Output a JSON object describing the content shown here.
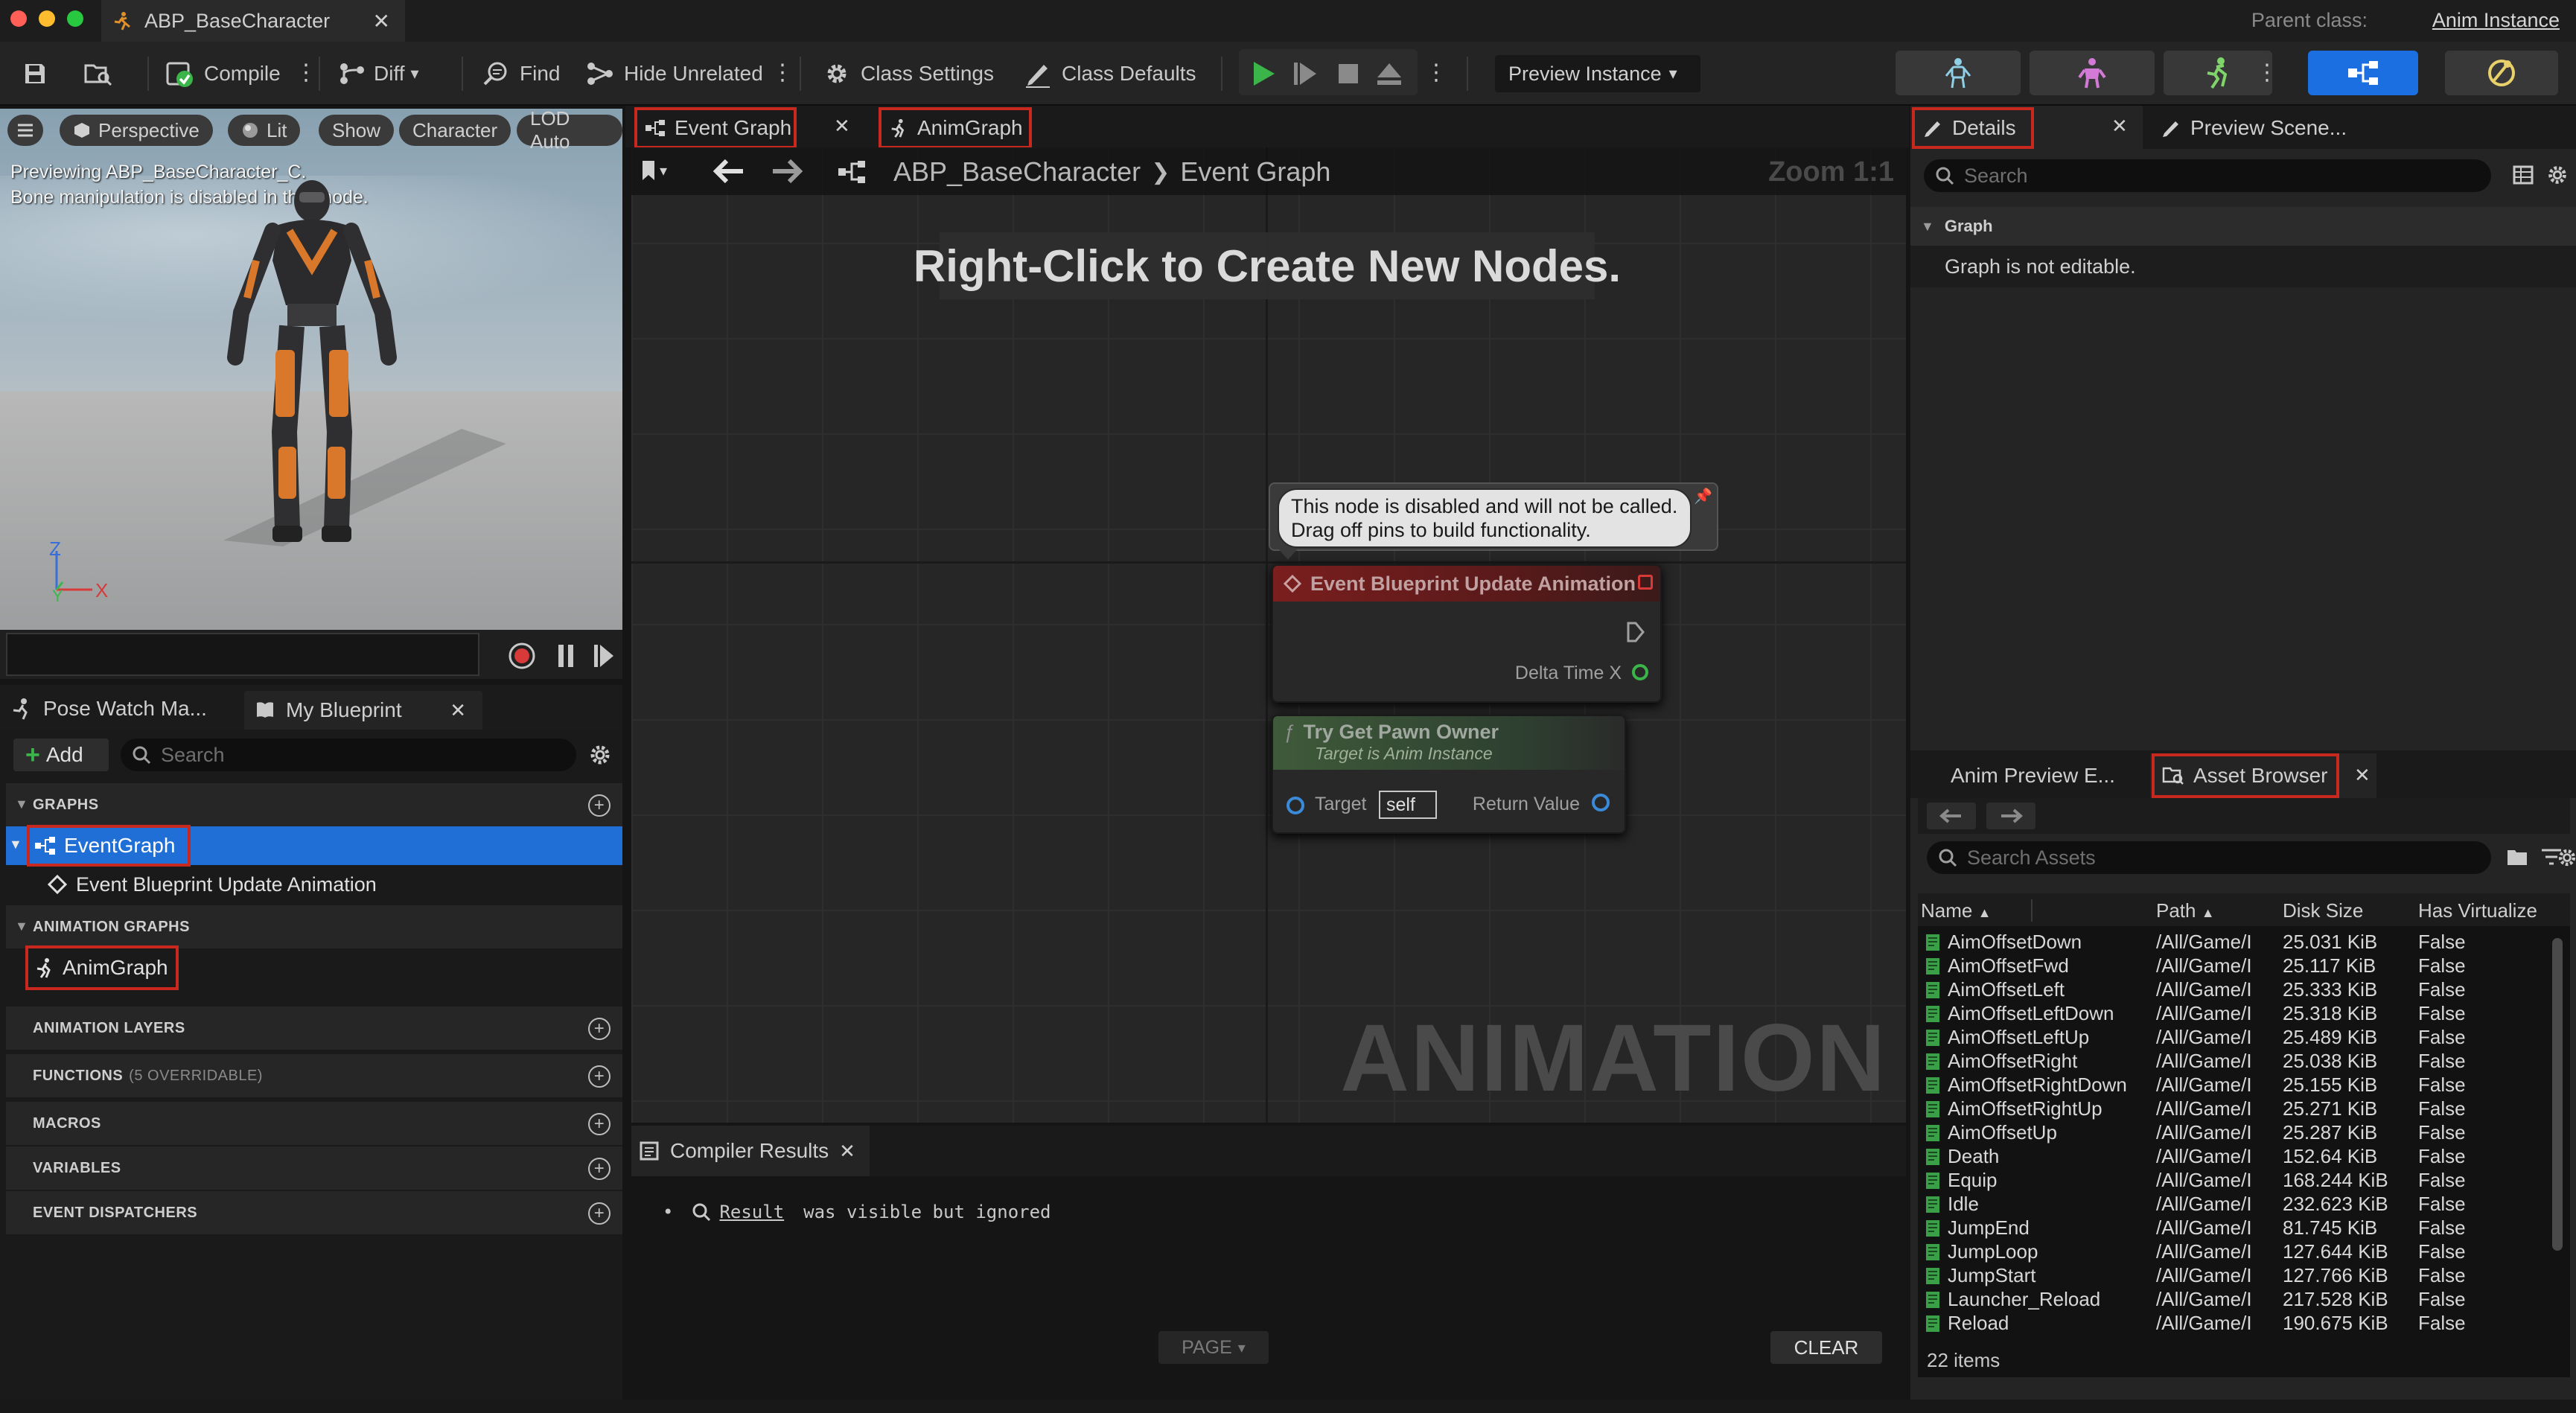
{
  "window": {
    "tab_title": "ABP_BaseCharacter",
    "parent_class_label": "Parent class:",
    "parent_class_value": "Anim Instance"
  },
  "toolbar": {
    "compile": "Compile",
    "diff": "Diff",
    "find": "Find",
    "hide_unrelated": "Hide Unrelated",
    "class_settings": "Class Settings",
    "class_defaults": "Class Defaults",
    "preview_instance": "Preview Instance"
  },
  "viewport": {
    "perspective": "Perspective",
    "lit": "Lit",
    "show": "Show",
    "character": "Character",
    "lod": "LOD Auto",
    "preview_line1": "Previewing ABP_BaseCharacter_C.",
    "preview_line2": "Bone manipulation is disabled in this mode.",
    "axis_z": "Z",
    "axis_y": "Y",
    "axis_x": "X"
  },
  "left_tabs": {
    "pose_watch": "Pose Watch Ma...",
    "my_blueprint": "My Blueprint"
  },
  "my_blueprint": {
    "add": "Add",
    "search_placeholder": "Search",
    "graphs": "GRAPHS",
    "event_graph": "EventGraph",
    "event_update": "Event Blueprint Update Animation",
    "animation_graphs": "ANIMATION GRAPHS",
    "anim_graph": "AnimGraph",
    "animation_layers": "ANIMATION LAYERS",
    "functions": "FUNCTIONS",
    "functions_note": "(5 OVERRIDABLE)",
    "macros": "MACROS",
    "variables": "VARIABLES",
    "event_dispatchers": "EVENT DISPATCHERS"
  },
  "graph_tabs": {
    "event_graph": "Event Graph",
    "anim_graph": "AnimGraph"
  },
  "graph": {
    "breadcrumb_root": "ABP_BaseCharacter",
    "breadcrumb_current": "Event Graph",
    "zoom": "Zoom 1:1",
    "hint": "Right-Click to Create New Nodes.",
    "watermark": "ANIMATION",
    "comment_line1": "This node is disabled and will not be called.",
    "comment_line2": "Drag off pins to build functionality.",
    "node1_title": "Event Blueprint Update Animation",
    "node1_pin": "Delta Time X",
    "node2_title": "Try Get Pawn Owner",
    "node2_subtitle": "Target is Anim Instance",
    "node2_target": "Target",
    "node2_self": "self",
    "node2_return": "Return Value"
  },
  "compiler": {
    "tab": "Compiler Results",
    "result_link": "Result",
    "result_text": "was visible but ignored",
    "page": "PAGE",
    "clear": "CLEAR"
  },
  "details": {
    "tab": "Details",
    "preview_tab": "Preview Scene...",
    "search_placeholder": "Search",
    "graph_section": "Graph",
    "not_editable": "Graph is not editable."
  },
  "asset_browser": {
    "anim_preview_tab": "Anim Preview E...",
    "tab": "Asset Browser",
    "search_placeholder": "Search Assets",
    "columns": [
      "Name",
      "Path",
      "Disk Size",
      "Has Virtualize"
    ],
    "rows": [
      [
        "AimOffsetDown",
        "/All/Game/I",
        "25.031 KiB",
        "False"
      ],
      [
        "AimOffsetFwd",
        "/All/Game/I",
        "25.117 KiB",
        "False"
      ],
      [
        "AimOffsetLeft",
        "/All/Game/I",
        "25.333 KiB",
        "False"
      ],
      [
        "AimOffsetLeftDown",
        "/All/Game/I",
        "25.318 KiB",
        "False"
      ],
      [
        "AimOffsetLeftUp",
        "/All/Game/I",
        "25.489 KiB",
        "False"
      ],
      [
        "AimOffsetRight",
        "/All/Game/I",
        "25.038 KiB",
        "False"
      ],
      [
        "AimOffsetRightDown",
        "/All/Game/I",
        "25.155 KiB",
        "False"
      ],
      [
        "AimOffsetRightUp",
        "/All/Game/I",
        "25.271 KiB",
        "False"
      ],
      [
        "AimOffsetUp",
        "/All/Game/I",
        "25.287 KiB",
        "False"
      ],
      [
        "Death",
        "/All/Game/I",
        "152.64 KiB",
        "False"
      ],
      [
        "Equip",
        "/All/Game/I",
        "168.244 KiB",
        "False"
      ],
      [
        "Idle",
        "/All/Game/I",
        "232.623 KiB",
        "False"
      ],
      [
        "JumpEnd",
        "/All/Game/I",
        "81.745 KiB",
        "False"
      ],
      [
        "JumpLoop",
        "/All/Game/I",
        "127.644 KiB",
        "False"
      ],
      [
        "JumpStart",
        "/All/Game/I",
        "127.766 KiB",
        "False"
      ],
      [
        "Launcher_Reload",
        "/All/Game/I",
        "217.528 KiB",
        "False"
      ],
      [
        "Reload",
        "/All/Game/I",
        "190.675 KiB",
        "False"
      ]
    ],
    "count": "22 items"
  }
}
